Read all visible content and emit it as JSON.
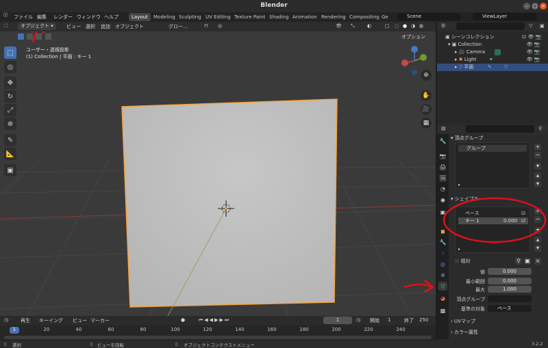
{
  "window": {
    "title": "Blender"
  },
  "menu": [
    "ファイル",
    "編集",
    "レンダー",
    "ウィンドウ",
    "ヘルプ"
  ],
  "workspaces": [
    "Layout",
    "Modeling",
    "Sculpting",
    "UV Editing",
    "Texture Paint",
    "Shading",
    "Animation",
    "Rendering",
    "Compositing",
    "Ge"
  ],
  "active_workspace": "Layout",
  "scene": {
    "name": "Scene"
  },
  "view_layer": {
    "name": "ViewLayer"
  },
  "viewport_header": {
    "mode": "オブジェクト",
    "menus": [
      "ビュー",
      "選択",
      "追加",
      "オブジェクト"
    ],
    "transform": "グロー…",
    "options": "オプション"
  },
  "viewport_overlay": {
    "view_name": "ユーザー・透視投影",
    "object_info": "(1) Collection | 平面 : キー 1"
  },
  "outliner": {
    "root": "シーンコレクション",
    "collection": "Collection",
    "items": [
      "Camera",
      "Light",
      "平面"
    ]
  },
  "properties": {
    "group_header": "頂点グループ",
    "group_item": "グループ",
    "shape_keys_header": "シェイプキー",
    "shape_keys": [
      {
        "name": "ベース",
        "value": ""
      },
      {
        "name": "キー 1",
        "value": "0.000"
      }
    ],
    "relative_label": "相対",
    "value_label": "値",
    "value": "0.000",
    "range_min_label": "最小範囲",
    "range_min": "0.000",
    "range_max_label": "最大",
    "range_max": "1.000",
    "vertex_group_label": "頂点グループ",
    "relative_to_label": "基準の対象",
    "relative_to": "ベース",
    "uv_maps_header": "UVマップ",
    "color_attr_header": "カラー属性"
  },
  "timeline": {
    "menus": [
      "再生",
      "キーイング",
      "ビュー",
      "マーカー"
    ],
    "current_frame": "1",
    "start_label": "開始",
    "start": "1",
    "end_label": "終了",
    "end": "250",
    "frames": [
      "1",
      "20",
      "40",
      "60",
      "80",
      "100",
      "120",
      "140",
      "160",
      "180",
      "200",
      "220",
      "240"
    ]
  },
  "statusbar": {
    "select": "選択",
    "rotate": "ビューを回転",
    "context_menu": "オブジェクトコンテクストメニュー",
    "version": "3.2.2"
  },
  "colors": {
    "accent": "#4772b3",
    "selection_outline": "#f5a33c",
    "plane_fill": "#bebebe",
    "grid": "#474747"
  }
}
